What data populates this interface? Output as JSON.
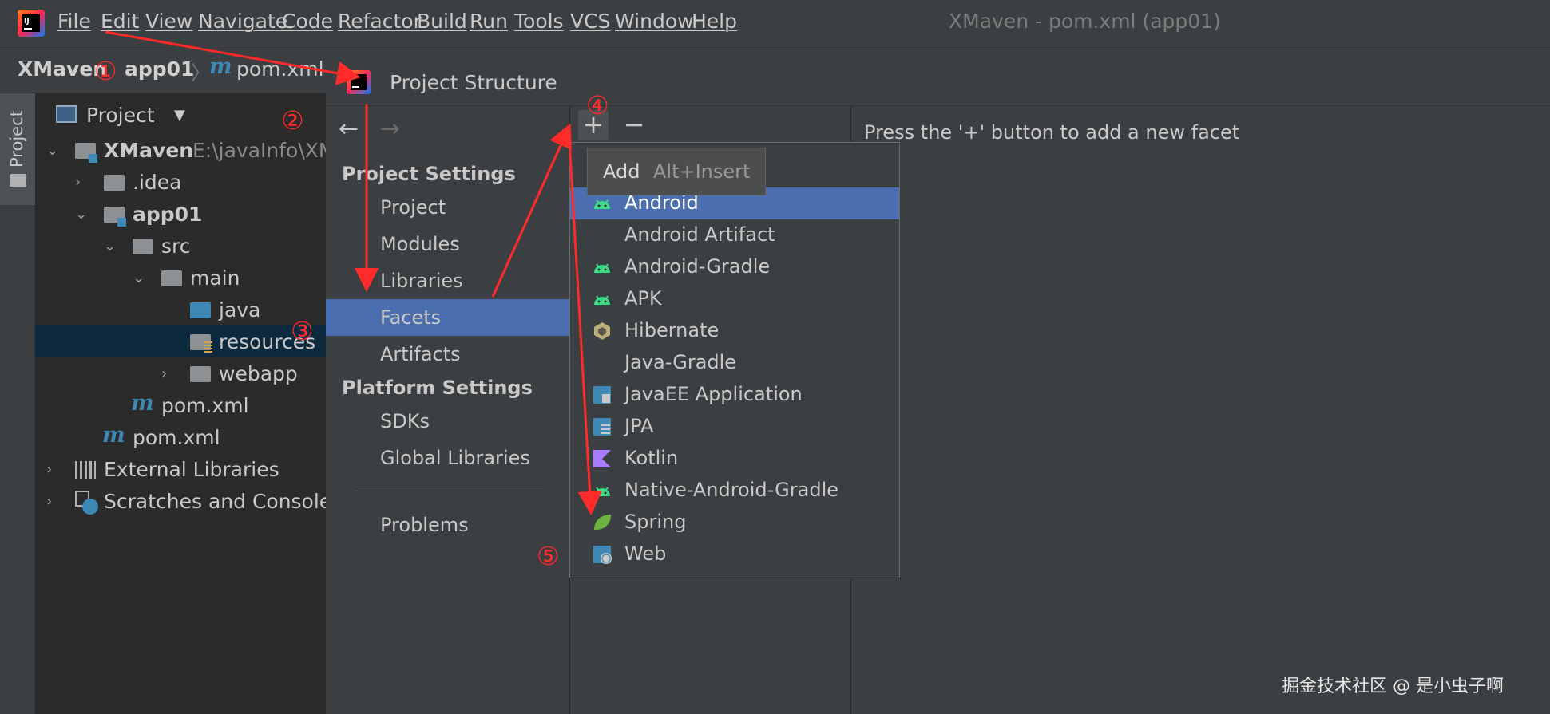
{
  "menubar": {
    "items": [
      "File",
      "Edit",
      "View",
      "Navigate",
      "Code",
      "Refactor",
      "Build",
      "Run",
      "Tools",
      "VCS",
      "Window",
      "Help"
    ],
    "window_title": "XMaven - pom.xml (app01)"
  },
  "breadcrumb": {
    "project": "XMaven",
    "module": "app01",
    "file": "pom.xml"
  },
  "tool_window_tab": "Project",
  "project_panel": {
    "title": "Project",
    "root_label": "XMaven",
    "root_path": "E:\\javaInfo\\XM",
    "nodes": {
      "idea": ".idea",
      "app01": "app01",
      "src": "src",
      "main": "main",
      "java": "java",
      "resources": "resources",
      "webapp": "webapp",
      "app_pom": "pom.xml",
      "root_pom": "pom.xml",
      "external_libraries": "External Libraries",
      "scratches": "Scratches and Consoles"
    }
  },
  "dialog": {
    "title": "Project Structure",
    "project_settings_header": "Project Settings",
    "project_settings_items": [
      "Project",
      "Modules",
      "Libraries",
      "Facets",
      "Artifacts"
    ],
    "selected_item": "Facets",
    "platform_settings_header": "Platform Settings",
    "platform_settings_items": [
      "SDKs",
      "Global Libraries"
    ],
    "problems": "Problems",
    "empty_message": "Press the '+' button to add a new facet",
    "plus_symbol": "+",
    "minus_symbol": "−"
  },
  "tooltip": {
    "label": "Add",
    "shortcut": "Alt+Insert"
  },
  "facet_popup": {
    "items": [
      "Android",
      "Android Artifact",
      "Android-Gradle",
      "APK",
      "Hibernate",
      "Java-Gradle",
      "JavaEE Application",
      "JPA",
      "Kotlin",
      "Native-Android-Gradle",
      "Spring",
      "Web"
    ],
    "selected": "Android"
  },
  "annotations": [
    "①",
    "②",
    "③",
    "④",
    "⑤"
  ],
  "watermark": "掘金技术社区 @ 是小虫子啊",
  "colors": {
    "selection": "#4b6eaf",
    "background": "#3c3f41",
    "annotation": "#ff2a2a",
    "android_green": "#3ddc84"
  }
}
